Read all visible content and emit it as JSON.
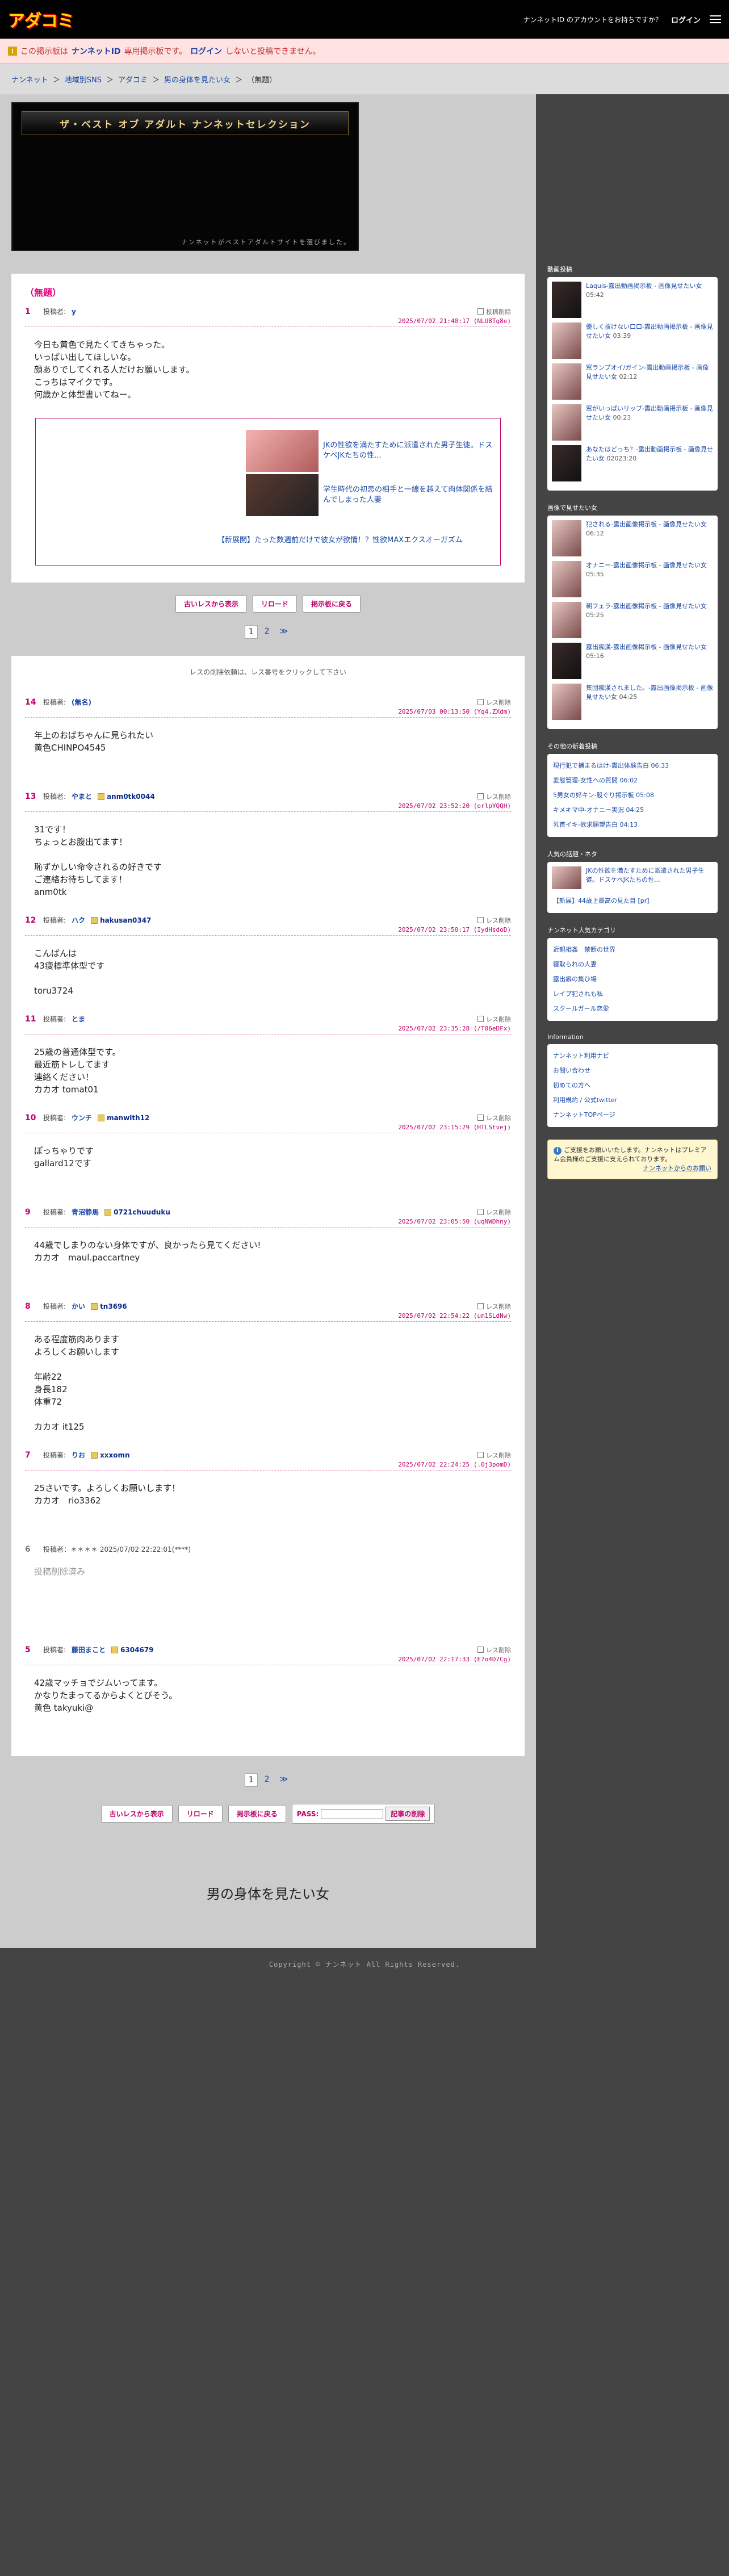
{
  "header": {
    "logo": "アダコミ",
    "account_prompt": "ナンネットID のアカウントをお持ちですか？",
    "login": "ログイン"
  },
  "notice": {
    "pre": "この掲示板は",
    "id": "ナンネットID",
    "mid": "専用掲示板です。",
    "login": "ログイン",
    "post": "しないと投稿できません。"
  },
  "breadcrumb": [
    "ナンネット",
    "地域別SNS",
    "アダコミ",
    "男の身体を見たい女",
    "（無題）"
  ],
  "banner": {
    "title": "ザ・ベスト オブ アダルト ナンネットセレクション",
    "sub": "ナンネットがベストアダルトサイトを選びました。"
  },
  "thread": {
    "title": "（無題）",
    "op": {
      "no": "1",
      "label": "投稿者:",
      "name": "y",
      "meta": "2025/07/02 21:40:17 (NLU8Tg8e)",
      "check": "投稿削除",
      "body": "今日も黄色で見たくてきちゃった。\nいっぱい出してほしいな。\n顔ありでしてくれる人だけお願いします。\nこっちはマイクです。\n何歳かと体型書いてねー。"
    }
  },
  "ad": {
    "items": [
      "JKの性欲を満たすために派遣された男子生徒。ドスケベJKたちの性...",
      "学生時代の初恋の相手と一線を越えて肉体関係を結んでしまった人妻"
    ],
    "footer": "【新展開】たった数週前だけで彼女が欲情！？性欲MAXエクスオーガズム"
  },
  "buttons": {
    "all": "古いレスから表示",
    "reload": "リロード",
    "back": "掲示板に戻る",
    "pass": "PASS:",
    "delete": "記事の削除"
  },
  "pager": {
    "p1": "1",
    "p2": "2",
    "next": "≫"
  },
  "hint": "レスの削除依頼は、レス番号をクリックして下さい",
  "post_label": "投稿者:",
  "check_label": "レス削除",
  "replies": [
    {
      "no": "14",
      "name": "(無名)",
      "trip": "",
      "meta": "2025/07/03 00:13:50 (Yq4.ZXdm)",
      "body": "年上のおばちゃんに見られたい\n黄色CHINPO4545"
    },
    {
      "no": "13",
      "name": "やまと",
      "trip": "anm0tk0044",
      "meta": "2025/07/02 23:52:20 (orlpYQQH)",
      "body": "31です！\nちょっとお腹出てます！\n\n恥ずかしい命令されるの好きです\nご連絡お待ちしてます！\nanm0tk"
    },
    {
      "no": "12",
      "name": "ハク",
      "trip": "hakusan0347",
      "meta": "2025/07/02 23:50:17 (IydHsdoD)",
      "body": "こんばんは\n43痩標準体型です\n\ntoru3724"
    },
    {
      "no": "11",
      "name": "とま",
      "trip": "",
      "meta": "2025/07/02 23:35:28 (/T06eDFx)",
      "body": "25歳の普通体型です。\n最近筋トレしてます\n連絡ください！\nカカオ tomat01"
    },
    {
      "no": "10",
      "name": "ウンチ",
      "trip": "manwith12",
      "meta": "2025/07/02 23:15:29 (HTLStvej)",
      "body": "ぽっちゃりです\ngallard12です"
    },
    {
      "no": "9",
      "name": "青沼静馬",
      "trip": "0721chuuduku",
      "meta": "2025/07/02 23:05:50 (uqNWDhny)",
      "body": "44歳でしまりのない身体ですが、良かったら見てください!\nカカオ　maul.paccartney"
    },
    {
      "no": "8",
      "name": "かい",
      "trip": "tn3696",
      "meta": "2025/07/02 22:54:22 (um1SLdNw)",
      "body": "ある程度筋肉あります\nよろしくお願いします\n\n年齢22\n身長182\n体重72\n\nカカオ it125"
    },
    {
      "no": "7",
      "name": "りお",
      "trip": "xxxomn",
      "meta": "2025/07/02 22:24:25 (.0j3pomD)",
      "body": "25さいです。よろしくお願いします！\nカカオ　rio3362"
    }
  ],
  "deleted": {
    "no": "6",
    "meta": "投稿者：＊＊＊＊ 2025/07/02 22:22:01(****)",
    "body": "投稿削除済み"
  },
  "last": {
    "no": "5",
    "name": "藤田まこと",
    "trip": "6304679",
    "meta": "2025/07/02 22:17:33 (E7o4D7Cg)",
    "body": "42歳マッチョでジムいってます。\nかなりたまってるからよくとびそう。\n黄色 takyuki@"
  },
  "footer": {
    "title": "男の身体を見たい女",
    "copy": "Copyright © ナンネット All Rights Reserved."
  },
  "side": {
    "s1": "動画投稿",
    "videos": [
      {
        "t": "Laquis-露出動画掲示板 - 画像見せたい女",
        "tm": "05:42"
      },
      {
        "t": "優しく抜けない口口-露出動画掲示板 - 画像見せたい女",
        "tm": "03:39"
      },
      {
        "t": "窓ランプオイ/ガイン-露出動画掲示板 - 画像見せたい女",
        "tm": "02:12"
      },
      {
        "t": "窓がいっぱいリップ-露出動画掲示板 - 画像見せたい女",
        "tm": "00:23"
      },
      {
        "t": "あなたはどっち？-露出動画掲示板 - 画像見せたい女",
        "tm": "02023:20"
      }
    ],
    "s2": "画像で見せたい女",
    "images": [
      {
        "t": "犯される-露出画像掲示板 - 画像見せたい女",
        "tm": "06:12"
      },
      {
        "t": "オナニー-露出画像掲示板 - 画像見せたい女",
        "tm": "05:35"
      },
      {
        "t": "朝フェラ-露出画像掲示板 - 画像見せたい女",
        "tm": "05:25"
      },
      {
        "t": "露出痴漢-露出画像掲示板 - 画像見せたい女",
        "tm": "05:16"
      },
      {
        "t": "集団痴漢されました。-露出画像掲示板 - 画像見せたい女",
        "tm": "04:25"
      }
    ],
    "s3": "その他の新着投稿",
    "others": [
      "現行犯で捕まるはけ-露出体験告白 06:33",
      "変態管理-女性への質問 06:02",
      "5男女の好キン-股ぐり掲示板 05:08",
      "キメキマ中-オナニー実況 04:25",
      "乳首イキ-欲求願望告白 04:13"
    ],
    "s4": "人気の話題・ネタ",
    "pop": {
      "t": "JKの性欲を満たすために派遣された男子生徒。ドスケベJKたちの性...",
      "f": "【新展】44歳上最高の見た目 [pr]"
    },
    "s5": "ナンネット人気カテゴリ",
    "cats": [
      "近親相姦　禁断の世界",
      "寝取られの人妻",
      "露出癖の集ひ場",
      "レイプ犯されも私",
      "スクールガール恋愛"
    ],
    "s6": "Information",
    "info": [
      "ナンネット利用ナビ",
      "お問い合わせ",
      "初めての方へ",
      "利用規約 / 公式twitter",
      "ナンネットTOPページ"
    ],
    "premium": "ご支援をお願いいたします。ナンネットはプレミアム会員様のご支援に支えられております。",
    "premium_link": "ナンネットからのお願い"
  }
}
